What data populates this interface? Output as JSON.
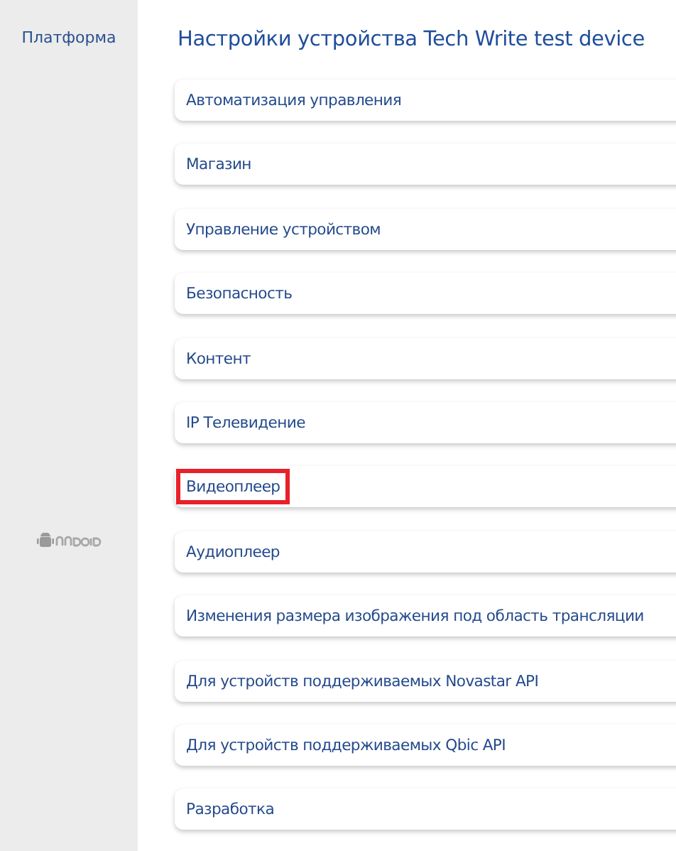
{
  "sidebar": {
    "label": "Платформа"
  },
  "title": "Настройки устройства Tech Write test device",
  "sections": [
    {
      "label": "Автоматизация управления",
      "highlighted": false
    },
    {
      "label": "Магазин",
      "highlighted": false
    },
    {
      "label": "Управление устройством",
      "highlighted": false
    },
    {
      "label": "Безопасность",
      "highlighted": false
    },
    {
      "label": "Контент",
      "highlighted": false
    },
    {
      "label": "IP Телевидение",
      "highlighted": false
    },
    {
      "label": "Видеоплеер",
      "highlighted": true
    },
    {
      "label": "Аудиоплеер",
      "highlighted": false
    },
    {
      "label": "Изменения размера изображения под область трансляции",
      "highlighted": false
    },
    {
      "label": "Для устройств поддерживаемых Novastar API",
      "highlighted": false
    },
    {
      "label": "Для устройств поддерживаемых Qbic API",
      "highlighted": false
    },
    {
      "label": "Разработка",
      "highlighted": false
    }
  ]
}
